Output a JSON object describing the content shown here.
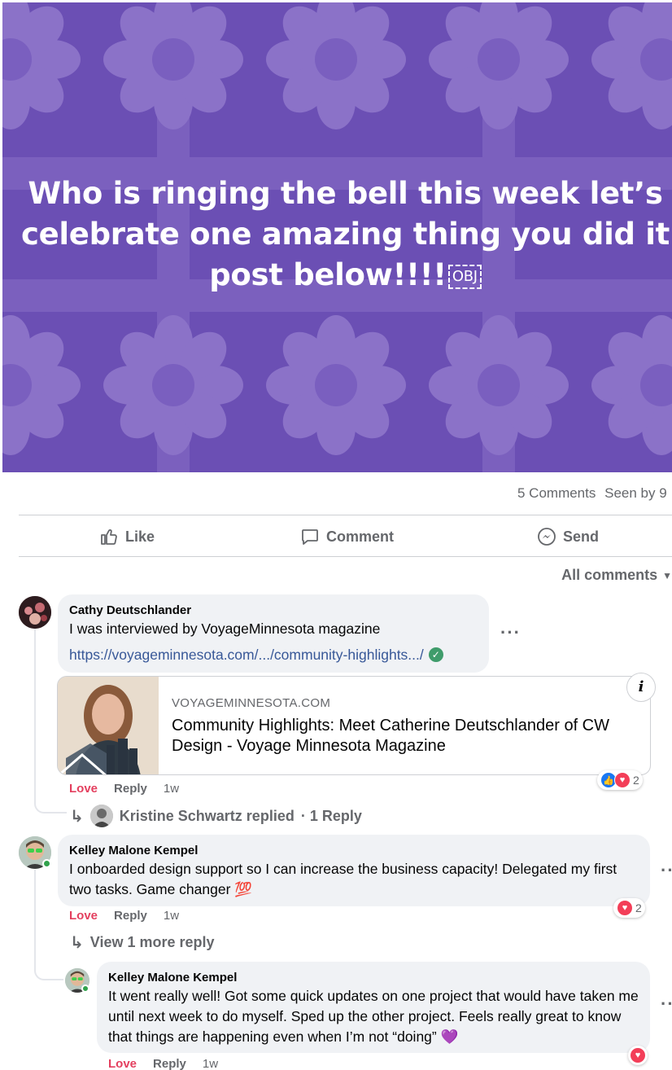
{
  "post": {
    "banner_text": "Who is ringing the bell this week let’s celebrate one amazing thing you did it post below!!!!",
    "banner_obj": "OBJ",
    "banner_color": "#6b4fb4",
    "comments_count": "5 Comments",
    "seen_by": "Seen by 9"
  },
  "actions": {
    "like": "Like",
    "comment": "Comment",
    "send": "Send"
  },
  "filter": {
    "label": "All comments"
  },
  "comments": [
    {
      "name": "Cathy Deutschlander",
      "text": "I was interviewed by VoyageMinnesota magazine",
      "link": "https://voyageminnesota.com/.../community-highlights.../",
      "preview": {
        "domain": "VOYAGEMINNESOTA.COM",
        "title": "Community Highlights: Meet Catherine Deutschlander of CW Design - Voyage Minnesota Magazine"
      },
      "love": "Love",
      "reply": "Reply",
      "time": "1w",
      "reaction_count": "2",
      "replied_name": "Kristine Schwartz replied",
      "replied_count": "· 1 Reply"
    },
    {
      "name": "Kelley Malone Kempel",
      "text": "I onboarded design support so I can increase the business capacity! Delegated my first two tasks. Game changer 💯",
      "love": "Love",
      "reply": "Reply",
      "time": "1w",
      "reaction_count": "2",
      "view_more": "View 1 more reply"
    },
    {
      "name": "Kelley Malone Kempel",
      "text": "It went really well! Got some quick updates on one project that would have taken me until next week to do myself. Sped up the other project. Feels really great to know that things are happening even when I’m not “doing” 💜",
      "love": "Love",
      "reply": "Reply",
      "time": "1w"
    }
  ],
  "colors": {
    "love": "#e4405f",
    "link": "#385898",
    "online": "#31a24c",
    "bubble": "#f0f2f5"
  }
}
